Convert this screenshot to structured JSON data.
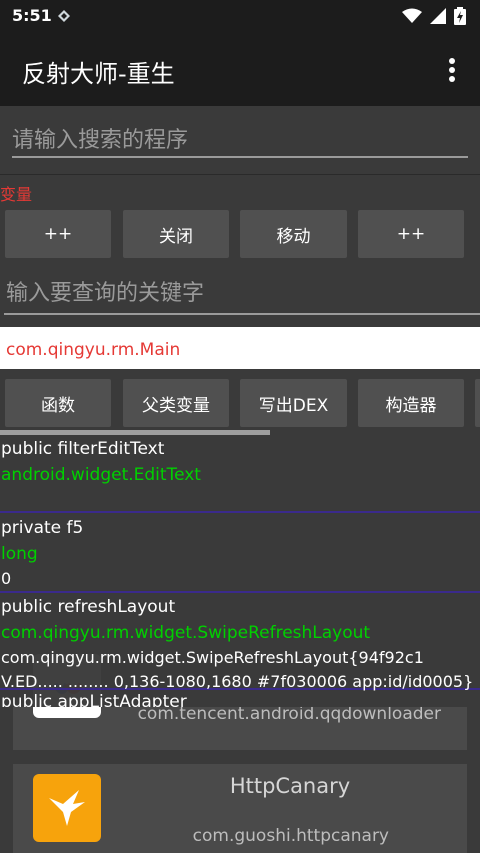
{
  "status_bar": {
    "time": "5:51"
  },
  "app_bar": {
    "title": "反射大师-重生"
  },
  "background_app": {
    "search_placeholder": "请输入搜索的程序",
    "apps": [
      {
        "package": "com.tencent.android.qqdownloader"
      },
      {
        "name": "HttpCanary",
        "package": "com.guoshi.httpcanary"
      }
    ]
  },
  "panel": {
    "section_label": "变量",
    "buttons_row1": [
      "++",
      "关闭",
      "移动",
      "++"
    ],
    "keyword_placeholder": "输入要查询的关键字",
    "current_class": "com.qingyu.rm.Main",
    "buttons_row2": [
      "函数",
      "父类变量",
      "写出DEX",
      "构造器"
    ],
    "fields": [
      {
        "name": "public filterEditText",
        "type": "android.widget.EditText",
        "value": ""
      },
      {
        "name": "private f5",
        "type": "long",
        "value": "0"
      },
      {
        "name": "public refreshLayout",
        "type": "com.qingyu.rm.widget.SwipeRefreshLayout",
        "value_line1": "com.qingyu.rm.widget.SwipeRefreshLayout{94f92c1",
        "value_line2": "V.ED..... ........ 0,136-1080,1680 #7f030006 app:id/id0005}"
      },
      {
        "name": "public appListAdapter"
      }
    ]
  },
  "colors": {
    "accent_red": "#e53935",
    "type_green": "#00d000",
    "divider": "#3a2a8c",
    "httpcanary_icon": "#f7a30c"
  }
}
